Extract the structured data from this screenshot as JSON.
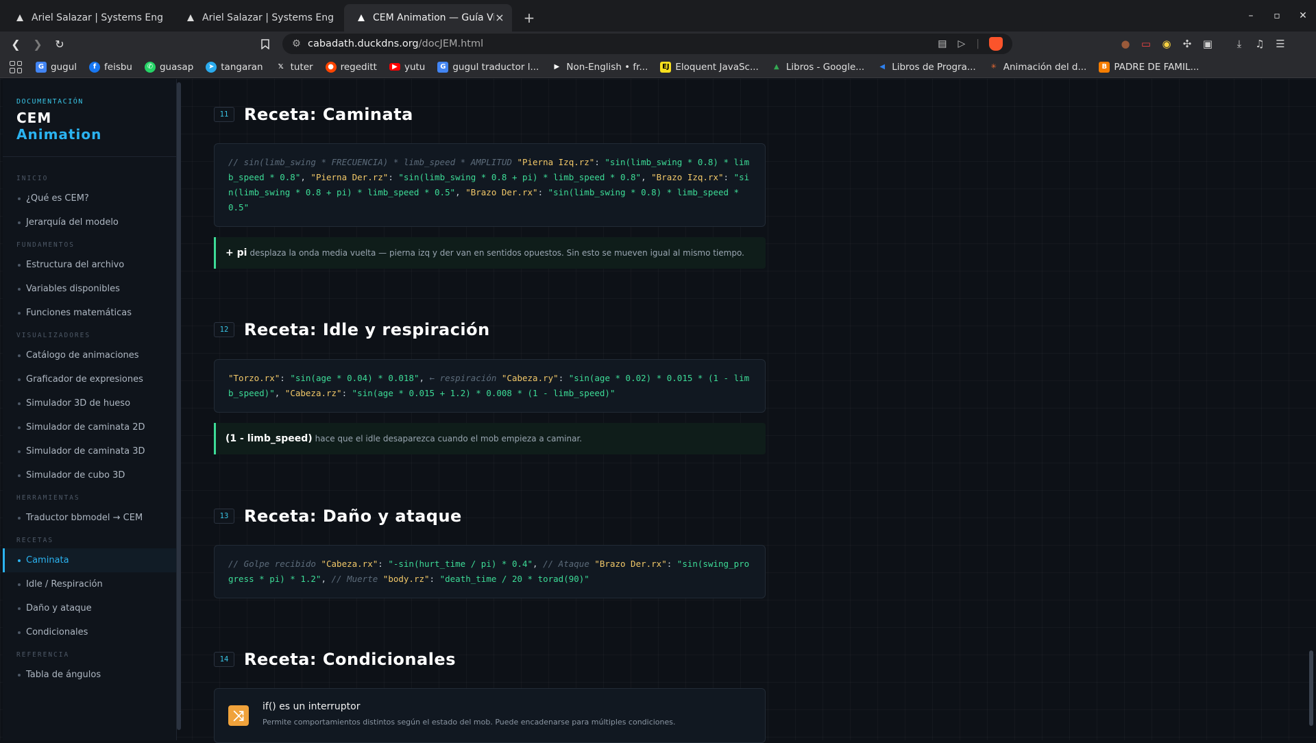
{
  "browser": {
    "tabs": [
      {
        "title": "Ariel Salazar | Systems Enginee",
        "active": false
      },
      {
        "title": "Ariel Salazar | Systems Enginee",
        "active": false
      },
      {
        "title": "CEM Animation — Guía Visu",
        "active": true
      }
    ],
    "url_host": "cabadath.duckdns.org",
    "url_path": "/docJEM.html",
    "bookmarks": [
      {
        "label": "gugul",
        "icon": "google-icon",
        "color": "#4285f4"
      },
      {
        "label": "feisbu",
        "icon": "facebook-icon",
        "color": "#1877f2"
      },
      {
        "label": "guasap",
        "icon": "whatsapp-icon",
        "color": "#25d366"
      },
      {
        "label": "tangaran",
        "icon": "telegram-icon",
        "color": "#2aabee"
      },
      {
        "label": "tuter",
        "icon": "x-icon",
        "color": "#000000"
      },
      {
        "label": "regeditt",
        "icon": "reddit-icon",
        "color": "#ff4500"
      },
      {
        "label": "yutu",
        "icon": "youtube-icon",
        "color": "#ff0000"
      },
      {
        "label": "gugul traductor l...",
        "icon": "translate-icon",
        "color": "#4285f4"
      },
      {
        "label": "Non-English • fr...",
        "icon": "play-icon",
        "color": "#222222"
      },
      {
        "label": "Eloquent JavaSc...",
        "icon": "ejs-icon",
        "color": "#f7df1e"
      },
      {
        "label": "Libros - Google...",
        "icon": "drive-icon",
        "color": "#34a853"
      },
      {
        "label": "Libros de Progra...",
        "icon": "bird-icon",
        "color": "#2f80ed"
      },
      {
        "label": "Animación del d...",
        "icon": "asterisk-icon",
        "color": "#e86a33"
      },
      {
        "label": "PADRE DE FAMIL...",
        "icon": "blogger-icon",
        "color": "#f57d00"
      }
    ]
  },
  "sidebar": {
    "kicker": "DOCUMENTACIÓN",
    "name_line1": "CEM",
    "name_line2": "Animation",
    "sections": [
      {
        "title": "INICIO",
        "items": [
          "¿Qué es CEM?",
          "Jerarquía del modelo"
        ]
      },
      {
        "title": "FUNDAMENTOS",
        "items": [
          "Estructura del archivo",
          "Variables disponibles",
          "Funciones matemáticas"
        ]
      },
      {
        "title": "VISUALIZADORES",
        "items": [
          "Catálogo de animaciones",
          "Graficador de expresiones",
          "Simulador 3D de hueso",
          "Simulador de caminata 2D",
          "Simulador de caminata 3D",
          "Simulador de cubo 3D"
        ]
      },
      {
        "title": "HERRAMIENTAS",
        "items": [
          "Traductor bbmodel → CEM"
        ]
      },
      {
        "title": "RECETAS",
        "items": [
          "Caminata",
          "Idle / Respiración",
          "Daño y ataque",
          "Condicionales"
        ]
      },
      {
        "title": "REFERENCIA",
        "items": [
          "Tabla de ángulos"
        ]
      }
    ],
    "active_item": "Caminata"
  },
  "content": {
    "s11": {
      "num": "11",
      "title": "Receta: Caminata",
      "code": [
        {
          "t": "cm",
          "v": "// sin(limb_swing * FRECUENCIA) * limb_speed * AMPLITUD "
        },
        {
          "t": "k",
          "v": "\"Pierna Izq.rz\""
        },
        {
          "t": "p",
          "v": ": "
        },
        {
          "t": "s",
          "v": "\"sin(limb_swing * 0.8) * limb_speed * 0.8\""
        },
        {
          "t": "p",
          "v": ", "
        },
        {
          "t": "k",
          "v": "\"Pierna Der.rz\""
        },
        {
          "t": "p",
          "v": ": "
        },
        {
          "t": "s",
          "v": "\"sin(limb_swing * 0.8 + pi) * limb_speed * 0.8\""
        },
        {
          "t": "p",
          "v": ", "
        },
        {
          "t": "k",
          "v": "\"Brazo Izq.rx\""
        },
        {
          "t": "p",
          "v": ": "
        },
        {
          "t": "s",
          "v": "\"sin(limb_swing * 0.8 + pi) * limb_speed * 0.5\""
        },
        {
          "t": "p",
          "v": ", "
        },
        {
          "t": "k",
          "v": "\"Brazo Der.rx\""
        },
        {
          "t": "p",
          "v": ": "
        },
        {
          "t": "s",
          "v": "\"sin(limb_swing * 0.8) * limb_speed * 0.5\""
        }
      ],
      "note_strong": "+ pi",
      "note_text": "desplaza la onda media vuelta — pierna izq y der van en sentidos opuestos. Sin esto se mueven igual al mismo tiempo."
    },
    "s12": {
      "num": "12",
      "title": "Receta: Idle y respiración",
      "code": [
        {
          "t": "k",
          "v": "\"Torzo.rx\""
        },
        {
          "t": "p",
          "v": ": "
        },
        {
          "t": "s",
          "v": "\"sin(age * 0.04) * 0.018\""
        },
        {
          "t": "p",
          "v": ", "
        },
        {
          "t": "cm",
          "v": "← respiración "
        },
        {
          "t": "k",
          "v": "\"Cabeza.ry\""
        },
        {
          "t": "p",
          "v": ": "
        },
        {
          "t": "s",
          "v": "\"sin(age * 0.02) * 0.015 * (1 - limb_speed)\""
        },
        {
          "t": "p",
          "v": ", "
        },
        {
          "t": "k",
          "v": "\"Cabeza.rz\""
        },
        {
          "t": "p",
          "v": ": "
        },
        {
          "t": "s",
          "v": "\"sin(age * 0.015 + 1.2) * 0.008 * (1 - limb_speed)\""
        }
      ],
      "note_strong": "(1 - limb_speed)",
      "note_text": "hace que el idle desaparezca cuando el mob empieza a caminar."
    },
    "s13": {
      "num": "13",
      "title": "Receta: Daño y ataque",
      "code": [
        {
          "t": "cm",
          "v": "// Golpe recibido "
        },
        {
          "t": "k",
          "v": "\"Cabeza.rx\""
        },
        {
          "t": "p",
          "v": ": "
        },
        {
          "t": "s",
          "v": "\"-sin(hurt_time / pi) * 0.4\""
        },
        {
          "t": "p",
          "v": ", "
        },
        {
          "t": "cm",
          "v": "// Ataque "
        },
        {
          "t": "k",
          "v": "\"Brazo Der.rx\""
        },
        {
          "t": "p",
          "v": ": "
        },
        {
          "t": "s",
          "v": "\"sin(swing_progress * pi) * 1.2\""
        },
        {
          "t": "p",
          "v": ", "
        },
        {
          "t": "cm",
          "v": "// Muerte "
        },
        {
          "t": "k",
          "v": "\"body.rz\""
        },
        {
          "t": "p",
          "v": ": "
        },
        {
          "t": "s",
          "v": "\"death_time / 20 * torad(90)\""
        }
      ]
    },
    "s14": {
      "num": "14",
      "title": "Receta: Condicionales",
      "card_title": "if() es un interruptor",
      "card_desc": "Permite comportamientos distintos según el estado del mob. Puede encadenarse para múltiples condiciones."
    }
  }
}
